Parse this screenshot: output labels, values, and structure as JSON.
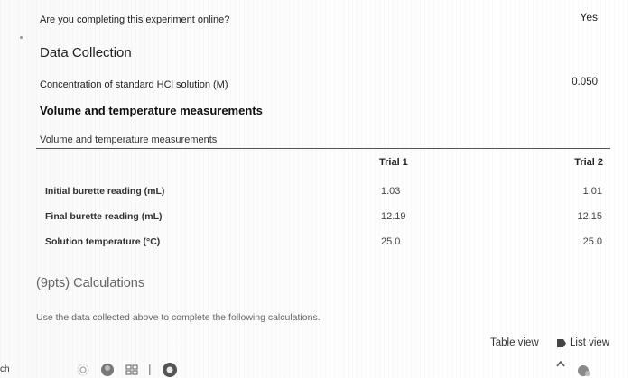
{
  "online_question": {
    "label": "Are you completing this experiment online?",
    "answer": "Yes"
  },
  "data_collection": {
    "title": "Data Collection",
    "concentration_label": "Concentration of standard HCl solution (M)",
    "concentration_value": "0.050"
  },
  "measurements": {
    "heading": "Volume and temperature measurements",
    "table_caption": "Volume and temperature measurements",
    "columns": [
      "",
      "Trial 1",
      "Trial 2"
    ],
    "rows": [
      {
        "label": "Initial burette reading (mL)",
        "trial1": "1.03",
        "trial2": "1.01"
      },
      {
        "label": "Final burette reading (mL)",
        "trial1": "12.19",
        "trial2": "12.15"
      },
      {
        "label": "Solution temperature (°C)",
        "trial1": "25.0",
        "trial2": "25.0"
      }
    ]
  },
  "calculations": {
    "title": "(9pts) Calculations",
    "instructions": "Use the data collected above to complete the following calculations."
  },
  "view_toggle": {
    "table_view": "Table view",
    "list_view": "List view"
  },
  "edge_fragment": "ch",
  "icons": {
    "list_view": "list-view-icon",
    "caret": "caret-up-icon",
    "taskbar": [
      "settings-icon",
      "app-icon",
      "grid-icon",
      "divider-icon",
      "browser-icon"
    ],
    "tray": "tray-icon"
  }
}
